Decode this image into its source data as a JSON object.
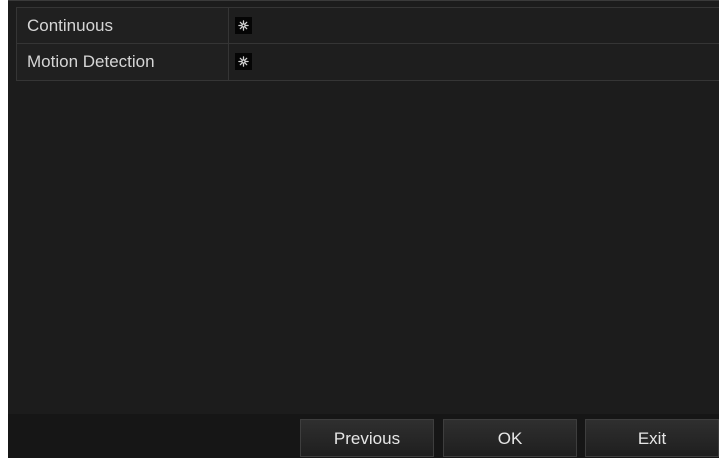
{
  "rows": [
    {
      "label": "Continuous",
      "icon": "gear-icon"
    },
    {
      "label": "Motion Detection",
      "icon": "gear-icon"
    }
  ],
  "footer": {
    "previous_label": "Previous",
    "ok_label": "OK",
    "exit_label": "Exit"
  },
  "colors": {
    "background": "#1c1c1c",
    "text": "#d6d6d6",
    "border": "#353535"
  }
}
